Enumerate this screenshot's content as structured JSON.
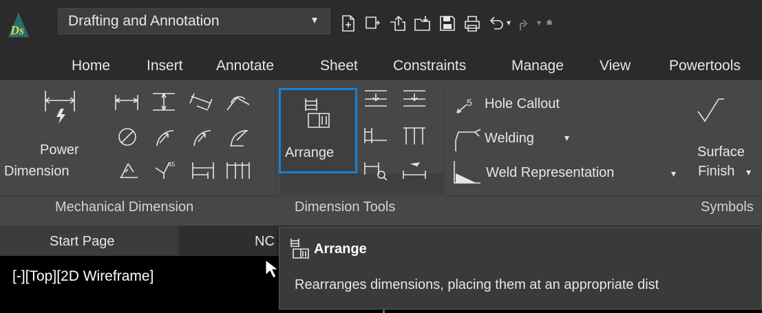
{
  "workspace": {
    "selected": "Drafting and Annotation"
  },
  "quick_access": [
    "new-document-icon",
    "new-sheet-icon",
    "open-icon",
    "import-icon",
    "save-icon",
    "print-icon",
    "undo-icon",
    "redo-icon",
    "customize-icon"
  ],
  "tabs": [
    "Home",
    "Insert",
    "Annotate",
    "Sheet",
    "Constraints",
    "Manage",
    "View",
    "Powertools"
  ],
  "ribbon": {
    "power_dimension": {
      "line1": "Power",
      "line2": "Dimension"
    },
    "arrange": "Arrange",
    "hole_callout": "Hole Callout",
    "welding": "Welding",
    "weld_representation": "Weld Representation",
    "surface_finish": {
      "line1": "Surface",
      "line2": "Finish"
    },
    "panels": [
      "Mechanical Dimension",
      "Dimension Tools",
      "Symbols"
    ]
  },
  "doc_tabs": [
    "Start Page",
    "NC"
  ],
  "viewport_label": "[-][Top][2D Wireframe]",
  "tooltip": {
    "title": "Arrange",
    "description": "Rearranges dimensions, placing them at an appropriate dist"
  },
  "colors": {
    "accent": "#1c7fd6",
    "background": "#3a3a3a",
    "tab_bar": "#2b2b2b"
  }
}
